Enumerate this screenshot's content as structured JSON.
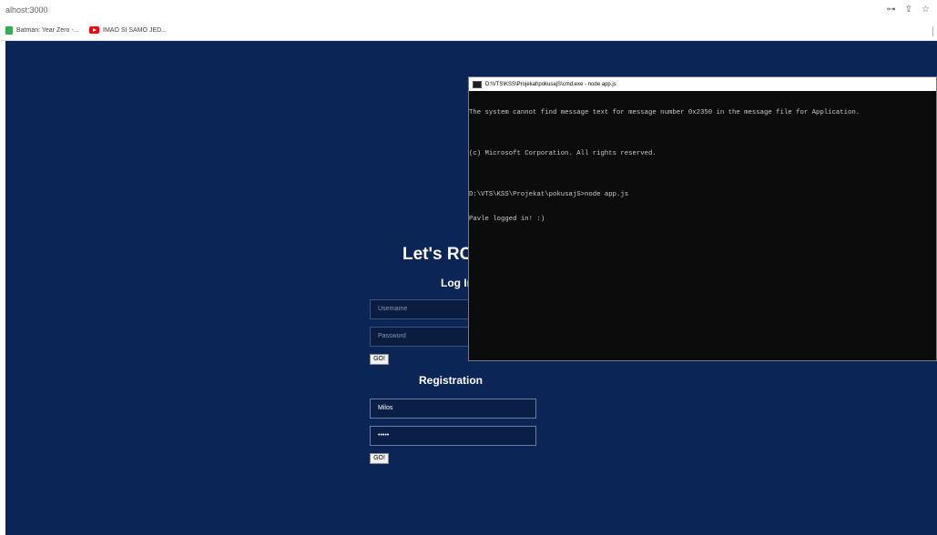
{
  "browser": {
    "url": "alhost:3000",
    "bookmarks": [
      {
        "label": "Batman: Year Zero -..."
      },
      {
        "label": "IMAO SI SAMO JED..."
      }
    ]
  },
  "page": {
    "heading": "Let's RC",
    "login": {
      "title": "Log Ir",
      "username_placeholder": "Username",
      "password_placeholder": "Password",
      "button": "GO!"
    },
    "registration": {
      "title": "Registration",
      "username_value": "Milos",
      "password_value": "•••••",
      "button": "GO!"
    }
  },
  "terminal": {
    "title": "D:\\VTS\\KSS\\Projekat\\pokusajS\\cmd.exe - node  app.js",
    "lines": [
      "The system cannot find message text for message number 0x2350 in the message file for Application.",
      "",
      "(c) Microsoft Corporation. All rights reserved.",
      "",
      "D:\\VTS\\KSS\\Projekat\\pokusajS>node app.js",
      "Pavle logged in! :)"
    ]
  }
}
